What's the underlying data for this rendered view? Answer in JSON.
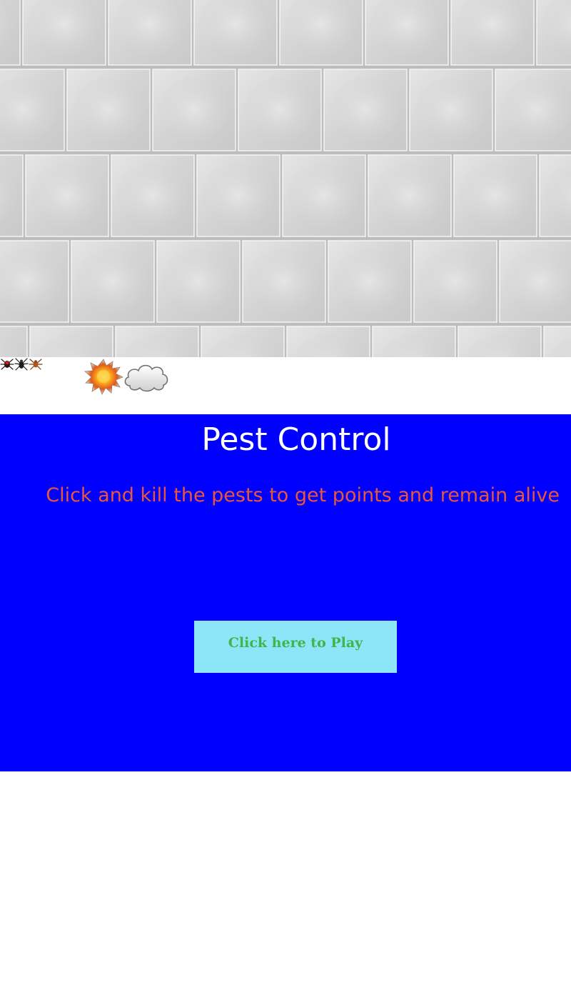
{
  "game": {
    "title": "Pest Control",
    "instructions": "Click and kill the pests to get points and remain alive",
    "play_button_label": "Click here to Play"
  },
  "sprites": [
    {
      "name": "red-bug-icon"
    },
    {
      "name": "black-spider-icon"
    },
    {
      "name": "orange-spider-icon"
    },
    {
      "name": "explosion-icon"
    },
    {
      "name": "smoke-cloud-icon"
    }
  ],
  "colors": {
    "panel_background": "#0000ff",
    "title_text": "#ffffff",
    "instructions_text": "#e8563b",
    "button_background": "#8ce6f7",
    "button_text": "#3fb54d",
    "tile_wall": "#d6d6d6"
  }
}
